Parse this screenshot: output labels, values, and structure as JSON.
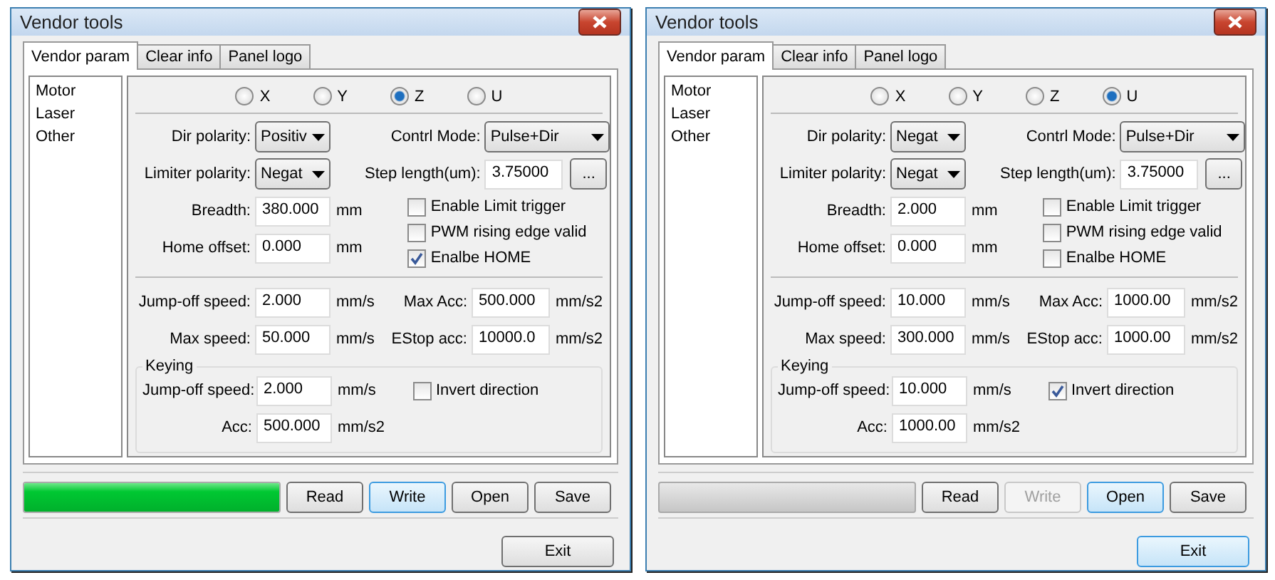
{
  "windows": [
    {
      "title": "Vendor tools",
      "tabs": [
        {
          "label": "Vendor param",
          "selected": true
        },
        {
          "label": "Clear info",
          "selected": false
        },
        {
          "label": "Panel logo",
          "selected": false
        }
      ],
      "sidebar": [
        "Motor",
        "Laser",
        "Other"
      ],
      "axes": [
        {
          "label": "X",
          "selected": false
        },
        {
          "label": "Y",
          "selected": false
        },
        {
          "label": "Z",
          "selected": true
        },
        {
          "label": "U",
          "selected": false
        }
      ],
      "left_fields": [
        {
          "kind": "select",
          "label": "Dir polarity:",
          "value": "Positiv"
        },
        {
          "kind": "select",
          "label": "Limiter polarity:",
          "value": "Negat"
        },
        {
          "kind": "input",
          "label": "Breadth:",
          "value": "380.000",
          "unit": "mm"
        },
        {
          "kind": "input",
          "label": "Home offset:",
          "value": "0.000",
          "unit": "mm"
        }
      ],
      "control_mode": {
        "label": "Contrl Mode:",
        "value": "Pulse+Dir"
      },
      "step_length": {
        "label": "Step length(um):",
        "value": "3.75000",
        "button": "..."
      },
      "checkboxes": [
        {
          "label": "Enable Limit trigger",
          "checked": false
        },
        {
          "label": "PWM rising edge valid",
          "checked": false
        },
        {
          "label": "Enalbe HOME",
          "checked": true
        }
      ],
      "speeds": [
        {
          "label": "Jump-off speed:",
          "value": "2.000",
          "unit": "mm/s"
        },
        {
          "label": "Max Acc:",
          "value": "500.000",
          "unit": "mm/s2"
        },
        {
          "label": "Max speed:",
          "value": "50.000",
          "unit": "mm/s"
        },
        {
          "label": "EStop acc:",
          "value": "10000.0",
          "unit": "mm/s2"
        }
      ],
      "keying": {
        "title": "Keying",
        "fields": [
          {
            "label": "Jump-off speed:",
            "value": "2.000",
            "unit": "mm/s"
          },
          {
            "label": "Acc:",
            "value": "500.000",
            "unit": "mm/s2"
          }
        ],
        "checkbox": {
          "label": "Invert direction",
          "checked": false
        }
      },
      "progress": {
        "level": 1
      },
      "buttons": [
        {
          "label": "Read",
          "disabled": false,
          "focused": false
        },
        {
          "label": "Write",
          "disabled": false,
          "focused": true
        },
        {
          "label": "Open",
          "disabled": false,
          "focused": false
        },
        {
          "label": "Save",
          "disabled": false,
          "focused": false
        }
      ],
      "exit": {
        "label": "Exit",
        "focused": false
      }
    },
    {
      "title": "Vendor tools",
      "tabs": [
        {
          "label": "Vendor param",
          "selected": true
        },
        {
          "label": "Clear info",
          "selected": false
        },
        {
          "label": "Panel logo",
          "selected": false
        }
      ],
      "sidebar": [
        "Motor",
        "Laser",
        "Other"
      ],
      "axes": [
        {
          "label": "X",
          "selected": false
        },
        {
          "label": "Y",
          "selected": false
        },
        {
          "label": "Z",
          "selected": false
        },
        {
          "label": "U",
          "selected": true
        }
      ],
      "left_fields": [
        {
          "kind": "select",
          "label": "Dir polarity:",
          "value": "Negat"
        },
        {
          "kind": "select",
          "label": "Limiter polarity:",
          "value": "Negat"
        },
        {
          "kind": "input",
          "label": "Breadth:",
          "value": "2.000",
          "unit": "mm"
        },
        {
          "kind": "input",
          "label": "Home offset:",
          "value": "0.000",
          "unit": "mm"
        }
      ],
      "control_mode": {
        "label": "Contrl Mode:",
        "value": "Pulse+Dir"
      },
      "step_length": {
        "label": "Step length(um):",
        "value": "3.75000",
        "button": "..."
      },
      "checkboxes": [
        {
          "label": "Enable Limit trigger",
          "checked": false
        },
        {
          "label": "PWM rising edge valid",
          "checked": false
        },
        {
          "label": "Enalbe HOME",
          "checked": false
        }
      ],
      "speeds": [
        {
          "label": "Jump-off speed:",
          "value": "10.000",
          "unit": "mm/s"
        },
        {
          "label": "Max Acc:",
          "value": "1000.00",
          "unit": "mm/s2"
        },
        {
          "label": "Max speed:",
          "value": "300.000",
          "unit": "mm/s"
        },
        {
          "label": "EStop acc:",
          "value": "1000.00",
          "unit": "mm/s2"
        }
      ],
      "keying": {
        "title": "Keying",
        "fields": [
          {
            "label": "Jump-off speed:",
            "value": "10.000",
            "unit": "mm/s"
          },
          {
            "label": "Acc:",
            "value": "1000.00",
            "unit": "mm/s2"
          }
        ],
        "checkbox": {
          "label": "Invert direction",
          "checked": true
        }
      },
      "progress": {
        "level": 0
      },
      "buttons": [
        {
          "label": "Read",
          "disabled": false,
          "focused": false
        },
        {
          "label": "Write",
          "disabled": true,
          "focused": false
        },
        {
          "label": "Open",
          "disabled": false,
          "focused": true
        },
        {
          "label": "Save",
          "disabled": false,
          "focused": false
        }
      ],
      "exit": {
        "label": "Exit",
        "focused": true
      }
    }
  ]
}
